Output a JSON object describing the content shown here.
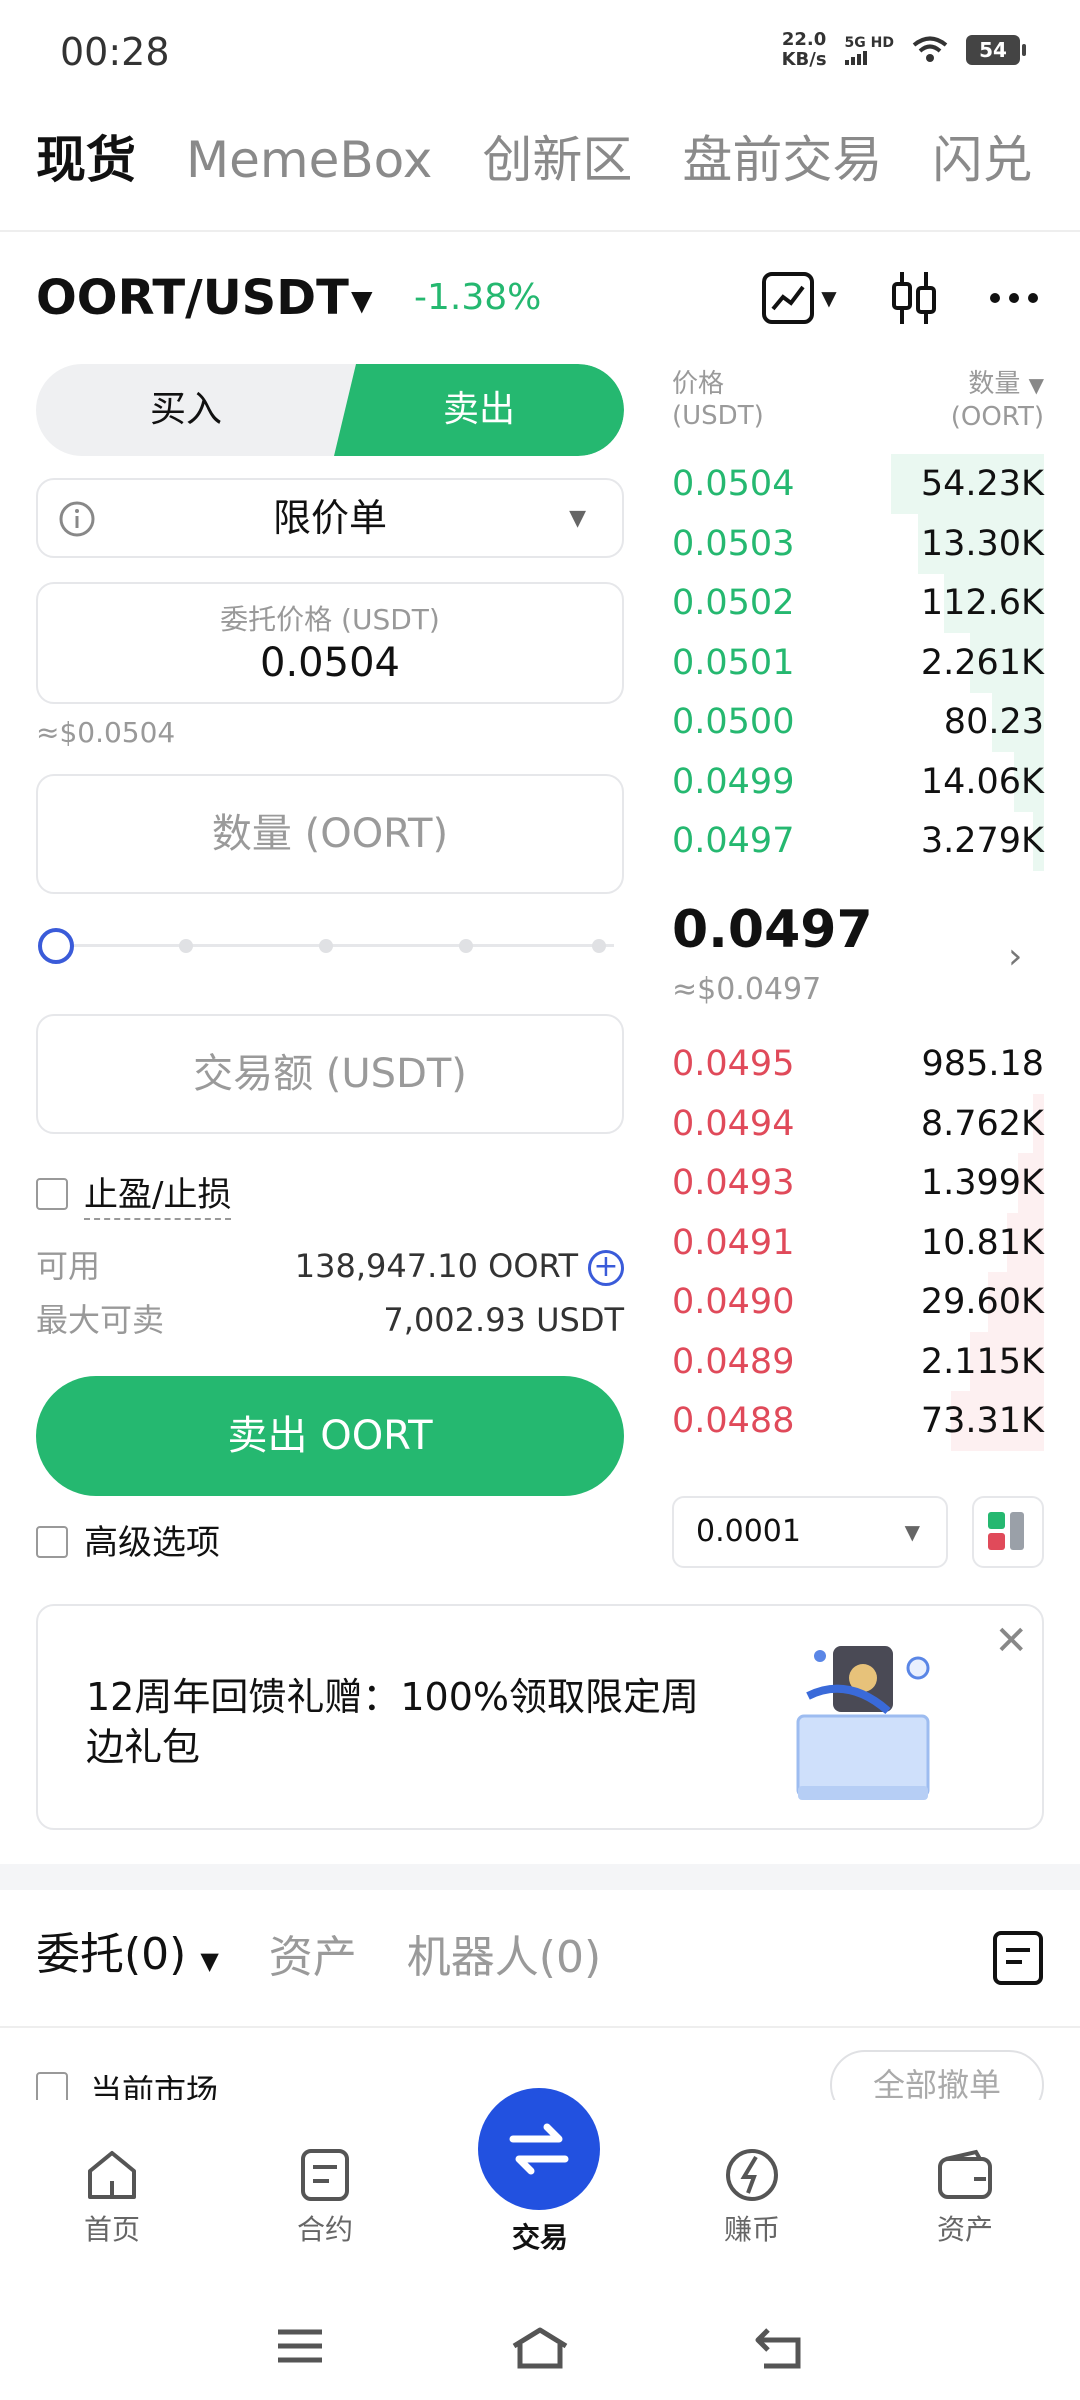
{
  "status_bar": {
    "time": "00:28",
    "net_speed": "22.0",
    "net_unit": "KB/s",
    "signal": "5G HD",
    "battery": "54"
  },
  "top_tabs": [
    "现货",
    "MemeBox",
    "创新区",
    "盘前交易",
    "闪兑"
  ],
  "pair": {
    "name": "OORT/USDT",
    "change": "-1.38%"
  },
  "trade": {
    "buy_label": "买入",
    "sell_label": "卖出",
    "order_type": "限价单",
    "price_caption": "委托价格 (USDT)",
    "price_value": "0.0504",
    "price_approx": "≈$0.0504",
    "qty_placeholder": "数量 (OORT)",
    "slider_percent": 0,
    "amount_placeholder": "交易额 (USDT)",
    "tpsl_label": "止盈/止损",
    "available_label": "可用",
    "available_value": "138,947.10 OORT",
    "max_sell_label": "最大可卖",
    "max_sell_value": "7,002.93 USDT",
    "submit_label": "卖出 OORT",
    "advanced_label": "高级选项"
  },
  "orderbook": {
    "price_header": "价格",
    "price_unit": "(USDT)",
    "qty_header": "数量",
    "qty_unit": "(OORT)",
    "asks": [
      {
        "price": "0.0504",
        "qty": "54.23K",
        "depth": 0.41
      },
      {
        "price": "0.0503",
        "qty": "13.30K",
        "depth": 0.34
      },
      {
        "price": "0.0502",
        "qty": "112.6K",
        "depth": 0.27
      },
      {
        "price": "0.0501",
        "qty": "2.261K",
        "depth": 0.2
      },
      {
        "price": "0.0500",
        "qty": "80.23",
        "depth": 0.14
      },
      {
        "price": "0.0499",
        "qty": "14.06K",
        "depth": 0.08
      },
      {
        "price": "0.0497",
        "qty": "3.279K",
        "depth": 0.03
      }
    ],
    "last_price": "0.0497",
    "last_price_approx": "≈$0.0497",
    "bids": [
      {
        "price": "0.0495",
        "qty": "985.18",
        "depth": 0.0
      },
      {
        "price": "0.0494",
        "qty": "8.762K",
        "depth": 0.03
      },
      {
        "price": "0.0493",
        "qty": "1.399K",
        "depth": 0.07
      },
      {
        "price": "0.0491",
        "qty": "10.81K",
        "depth": 0.1
      },
      {
        "price": "0.0490",
        "qty": "29.60K",
        "depth": 0.15
      },
      {
        "price": "0.0489",
        "qty": "2.115K",
        "depth": 0.2
      },
      {
        "price": "0.0488",
        "qty": "73.31K",
        "depth": 0.25
      }
    ],
    "tick_size": "0.0001"
  },
  "promo": {
    "text": "12周年回馈礼赠：100%领取限定周边礼包"
  },
  "bottom_tabs": {
    "orders": "委托(0)",
    "assets": "资产",
    "bots": "机器人(0)"
  },
  "filters": {
    "current_market": "当前市场",
    "cancel_all": "全部撤单"
  },
  "nav": {
    "home": "首页",
    "futures": "合约",
    "trade": "交易",
    "earn": "赚币",
    "assets": "资产"
  },
  "colors": {
    "up": "#25b870",
    "down": "#e04a5a",
    "accent": "#2251e0"
  }
}
